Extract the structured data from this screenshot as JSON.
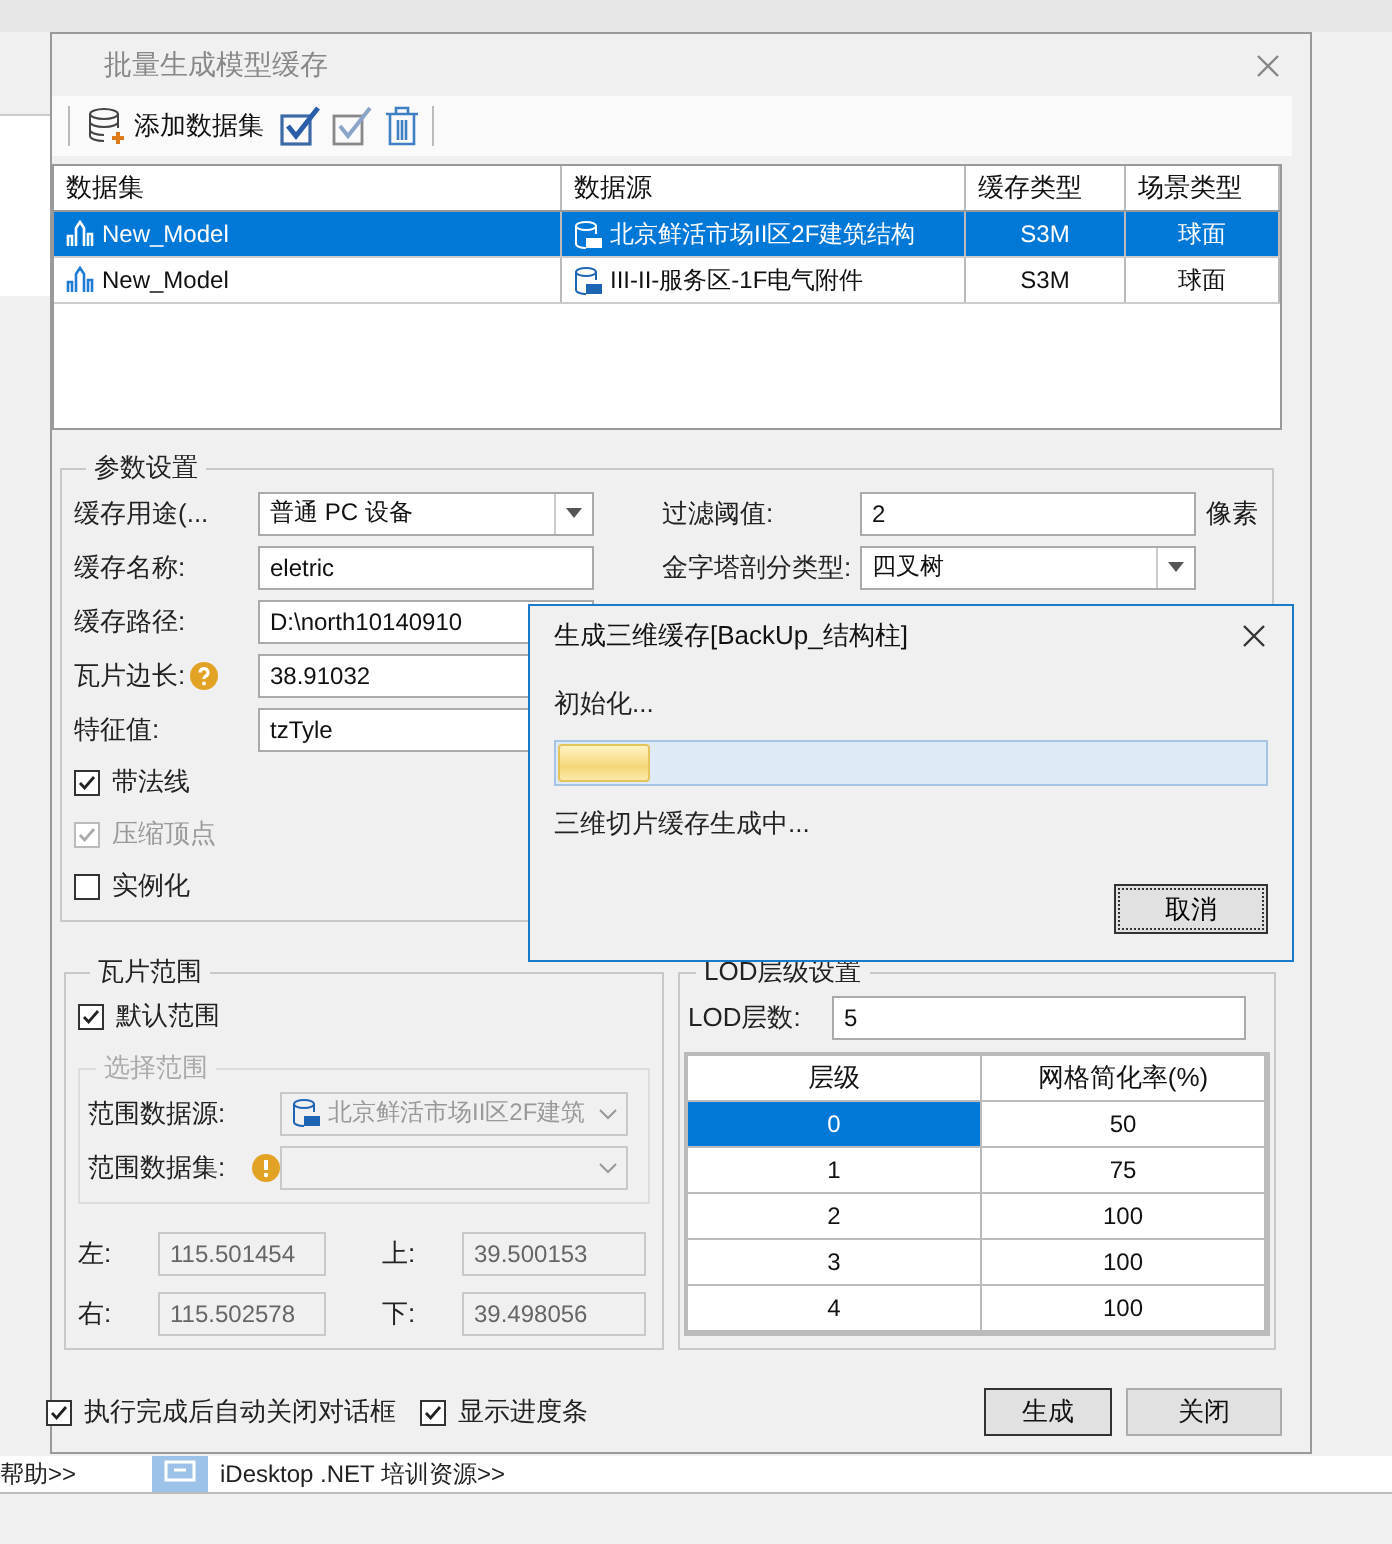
{
  "background_app": {
    "links": [
      "帮助>>",
      "iDesktop .NET 培训资源>>"
    ]
  },
  "dialog": {
    "title": "批量生成模型缓存"
  },
  "toolbar": {
    "add_label": "添加数据集"
  },
  "table": {
    "columns": [
      "数据集",
      "数据源",
      "缓存类型",
      "场景类型"
    ],
    "rows": [
      {
        "dataset": "New_Model",
        "datasource": "北京鲜活市场II区2F建筑结构",
        "cache_type": "S3M",
        "scene_type": "球面",
        "selected": true
      },
      {
        "dataset": "New_Model",
        "datasource": "III-II-服务区-1F电气附件",
        "cache_type": "S3M",
        "scene_type": "球面",
        "selected": false
      }
    ]
  },
  "params": {
    "title": "参数设置",
    "fields": [
      {
        "kind": "combo",
        "label": "缓存用途(...",
        "value": "普通 PC 设备"
      },
      {
        "kind": "text",
        "label": "缓存名称:",
        "value": "eletric"
      },
      {
        "kind": "text",
        "label": "缓存路径:",
        "value": "D:\\north10140910"
      },
      {
        "kind": "text",
        "label": "瓦片边长:",
        "value": "38.91032",
        "help": true
      },
      {
        "kind": "text",
        "label": "特征值:",
        "value": "tzTyle"
      }
    ],
    "right_fields": [
      {
        "kind": "text",
        "label": "过滤阈值:",
        "value": "2",
        "unit": "像素"
      },
      {
        "kind": "combo",
        "label": "金字塔剖分类型:",
        "value": "四叉树"
      }
    ],
    "checks": [
      {
        "label": "带法线",
        "checked": true,
        "disabled": false
      },
      {
        "label": "压缩顶点",
        "checked": true,
        "disabled": true
      },
      {
        "label": "实例化",
        "checked": false,
        "disabled": false
      }
    ]
  },
  "tile_range": {
    "title": "瓦片范围",
    "default_check": {
      "label": "默认范围",
      "checked": true
    },
    "sub_title": "选择范围",
    "source_label": "范围数据源:",
    "source_value": "北京鲜活市场II区2F建筑",
    "dataset_label": "范围数据集:",
    "coords": [
      {
        "label": "左:",
        "value": "115.501454"
      },
      {
        "label": "上:",
        "value": "39.500153"
      },
      {
        "label": "右:",
        "value": "115.502578"
      },
      {
        "label": "下:",
        "value": "39.498056"
      }
    ]
  },
  "lod": {
    "title": "LOD层级设置",
    "count_label": "LOD层数:",
    "count": "5",
    "columns": [
      "层级",
      "网格简化率(%)"
    ],
    "rows": [
      {
        "level": "0",
        "rate": "50",
        "selected": true
      },
      {
        "level": "1",
        "rate": "75",
        "selected": false
      },
      {
        "level": "2",
        "rate": "100",
        "selected": false
      },
      {
        "level": "3",
        "rate": "100",
        "selected": false
      },
      {
        "level": "4",
        "rate": "100",
        "selected": false
      }
    ]
  },
  "footer": {
    "checks": [
      {
        "label": "执行完成后自动关闭对话框",
        "checked": true
      },
      {
        "label": "显示进度条",
        "checked": true
      }
    ],
    "buttons": [
      "生成",
      "关闭"
    ]
  },
  "progress": {
    "title": "生成三维缓存[BackUp_结构柱]",
    "status": "初始化...",
    "level": 0.13,
    "message": "三维切片缓存生成中...",
    "cancel": "取消"
  }
}
